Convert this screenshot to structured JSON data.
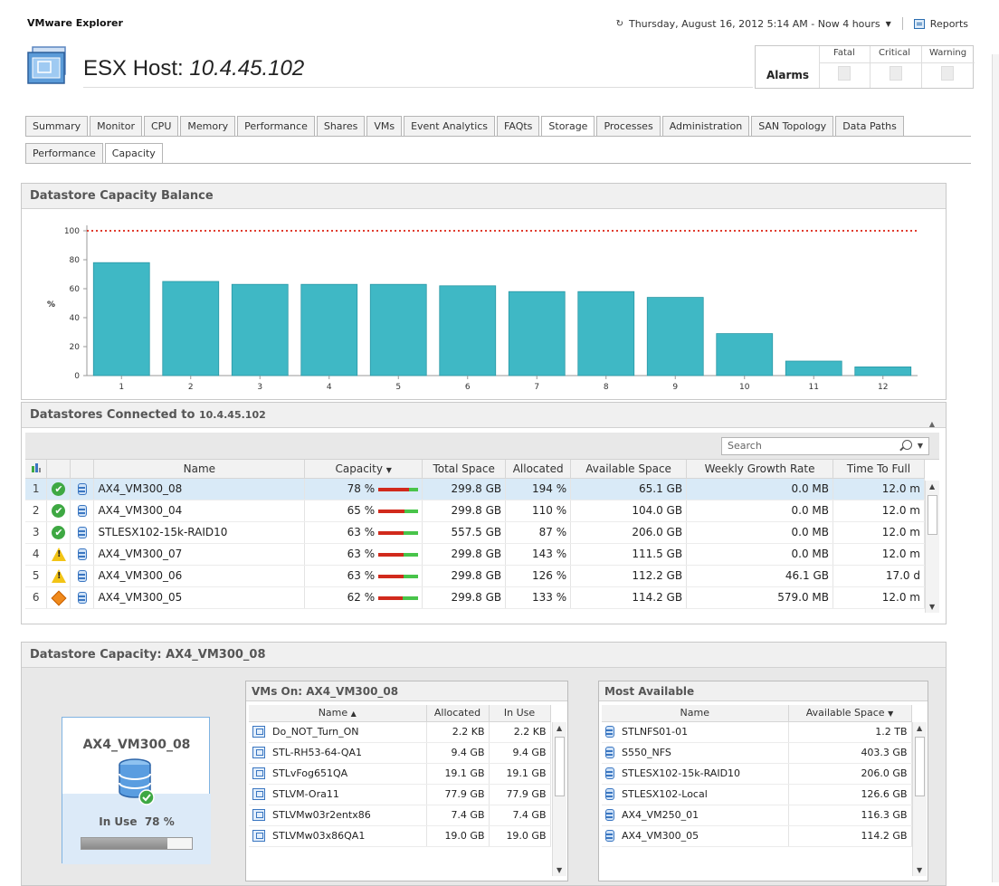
{
  "app": {
    "title": "VMware Explorer",
    "time_range": "Thursday, August 16, 2012 5:14 AM - Now 4 hours",
    "reports_label": "Reports"
  },
  "host": {
    "prefix": "ESX Host: ",
    "ip": "10.4.45.102"
  },
  "alarms": {
    "label": "Alarms",
    "columns": [
      "Fatal",
      "Critical",
      "Warning"
    ]
  },
  "tabs": [
    "Summary",
    "Monitor",
    "CPU",
    "Memory",
    "Performance",
    "Shares",
    "VMs",
    "Event Analytics",
    "FAQts",
    "Storage",
    "Processes",
    "Administration",
    "SAN Topology",
    "Data Paths"
  ],
  "active_tab": "Storage",
  "subtabs": [
    "Performance",
    "Capacity"
  ],
  "active_subtab": "Capacity",
  "capacity_balance": {
    "title": "Datastore Capacity Balance",
    "chart_data": {
      "type": "bar",
      "categories": [
        "1",
        "2",
        "3",
        "4",
        "5",
        "6",
        "7",
        "8",
        "9",
        "10",
        "11",
        "12"
      ],
      "values": [
        78,
        65,
        63,
        63,
        63,
        62,
        58,
        58,
        54,
        29,
        10,
        6
      ],
      "ylabel": "%",
      "ylim": [
        0,
        100
      ],
      "yticks": [
        0,
        20,
        40,
        60,
        80,
        100
      ],
      "threshold": 100,
      "bar_color": "#3fb8c5",
      "threshold_color": "#e03b2e"
    }
  },
  "datastores": {
    "title": "Datastores Connected to",
    "host": "10.4.45.102",
    "search_placeholder": "Search",
    "columns": [
      "Name",
      "Capacity",
      "Total Space",
      "Allocated",
      "Available Space",
      "Weekly Growth Rate",
      "Time To Full"
    ],
    "rows": [
      {
        "n": "1",
        "status": "ok",
        "name": "AX4_VM300_08",
        "capacity": "78 %",
        "cap_pct": 78,
        "total": "299.8 GB",
        "allocated": "194 %",
        "available": "65.1 GB",
        "growth": "0.0 MB",
        "ttf": "12.0 m"
      },
      {
        "n": "2",
        "status": "ok",
        "name": "AX4_VM300_04",
        "capacity": "65 %",
        "cap_pct": 65,
        "total": "299.8 GB",
        "allocated": "110 %",
        "available": "104.0 GB",
        "growth": "0.0 MB",
        "ttf": "12.0 m"
      },
      {
        "n": "3",
        "status": "ok",
        "name": "STLESX102-15k-RAID10",
        "capacity": "63 %",
        "cap_pct": 63,
        "total": "557.5 GB",
        "allocated": "87 %",
        "available": "206.0 GB",
        "growth": "0.0 MB",
        "ttf": "12.0 m"
      },
      {
        "n": "4",
        "status": "warning",
        "name": "AX4_VM300_07",
        "capacity": "63 %",
        "cap_pct": 63,
        "total": "299.8 GB",
        "allocated": "143 %",
        "available": "111.5 GB",
        "growth": "0.0 MB",
        "ttf": "12.0 m"
      },
      {
        "n": "5",
        "status": "warning",
        "name": "AX4_VM300_06",
        "capacity": "63 %",
        "cap_pct": 63,
        "total": "299.8 GB",
        "allocated": "126 %",
        "available": "112.2 GB",
        "growth": "46.1 GB",
        "ttf": "17.0 d"
      },
      {
        "n": "6",
        "status": "critical",
        "name": "AX4_VM300_05",
        "capacity": "62 %",
        "cap_pct": 62,
        "total": "299.8 GB",
        "allocated": "133 %",
        "available": "114.2 GB",
        "growth": "579.0 MB",
        "ttf": "12.0 m"
      }
    ]
  },
  "ds_capacity": {
    "title": "Datastore Capacity: AX4_VM300_08",
    "card": {
      "name": "AX4_VM300_08",
      "in_use_label": "In Use",
      "in_use_value": "78 %",
      "in_use_pct": 78
    },
    "vms_on": {
      "title": "VMs On: AX4_VM300_08",
      "columns": [
        "Name",
        "Allocated",
        "In Use"
      ],
      "rows": [
        {
          "name": "Do_NOT_Turn_ON",
          "allocated": "2.2 KB",
          "in_use": "2.2 KB"
        },
        {
          "name": "STL-RH53-64-QA1",
          "allocated": "9.4 GB",
          "in_use": "9.4 GB"
        },
        {
          "name": "STLvFog651QA",
          "allocated": "19.1 GB",
          "in_use": "19.1 GB"
        },
        {
          "name": "STLVM-Ora11",
          "allocated": "77.9 GB",
          "in_use": "77.9 GB"
        },
        {
          "name": "STLVMw03r2entx86",
          "allocated": "7.4 GB",
          "in_use": "7.4 GB"
        },
        {
          "name": "STLVMw03x86QA1",
          "allocated": "19.0 GB",
          "in_use": "19.0 GB"
        }
      ]
    },
    "most_available": {
      "title": "Most Available",
      "columns": [
        "Name",
        "Available Space"
      ],
      "rows": [
        {
          "name": "STLNFS01-01",
          "available": "1.2 TB"
        },
        {
          "name": "S550_NFS",
          "available": "403.3 GB"
        },
        {
          "name": "STLESX102-15k-RAID10",
          "available": "206.0 GB"
        },
        {
          "name": "STLESX102-Local",
          "available": "126.6 GB"
        },
        {
          "name": "AX4_VM250_01",
          "available": "116.3 GB"
        },
        {
          "name": "AX4_VM300_05",
          "available": "114.2 GB"
        }
      ]
    }
  }
}
